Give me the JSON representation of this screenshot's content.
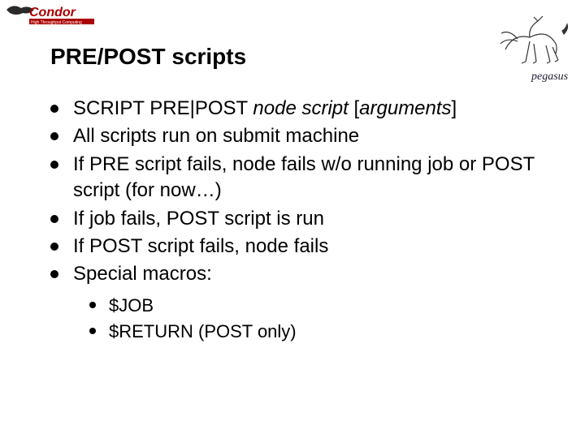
{
  "logos": {
    "condor": "Condor",
    "condor_sub": "High Throughput Computing",
    "pegasus": "pegasus"
  },
  "title": "PRE/POST scripts",
  "bullets": [
    {
      "parts": [
        {
          "text": "SCRIPT PRE|POST ",
          "italic": false
        },
        {
          "text": "node script ",
          "italic": true
        },
        {
          "text": "[",
          "italic": false
        },
        {
          "text": "arguments",
          "italic": true
        },
        {
          "text": "]",
          "italic": false
        }
      ]
    },
    {
      "parts": [
        {
          "text": "All scripts run on submit machine",
          "italic": false
        }
      ]
    },
    {
      "parts": [
        {
          "text": "If PRE script fails, node fails w/o running job or POST script (for now…)",
          "italic": false
        }
      ]
    },
    {
      "parts": [
        {
          "text": "If job fails, POST script is run",
          "italic": false
        }
      ]
    },
    {
      "parts": [
        {
          "text": "If POST script fails, node fails",
          "italic": false
        }
      ]
    },
    {
      "parts": [
        {
          "text": "Special macros:",
          "italic": false
        }
      ]
    }
  ],
  "sub_bullets": [
    {
      "text": "$JOB"
    },
    {
      "text": "$RETURN (POST only)"
    }
  ]
}
